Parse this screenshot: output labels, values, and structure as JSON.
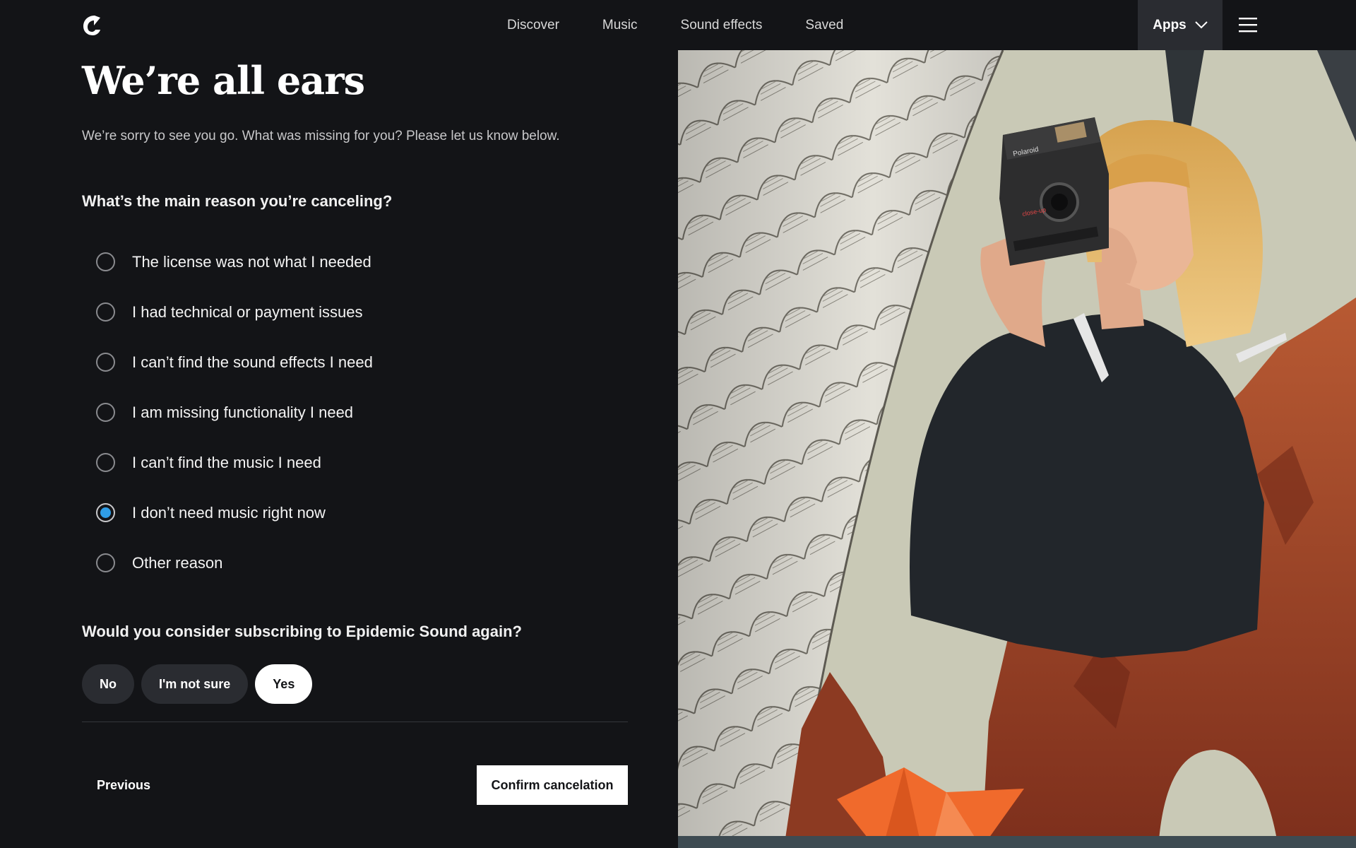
{
  "nav": {
    "logo_icon": "epidemic-sound-logo-icon",
    "links": [
      "Discover",
      "Music",
      "Sound effects",
      "Saved"
    ],
    "apps_label": "Apps",
    "apps_icon": "chevron-down-icon",
    "menu_icon": "hamburger-menu-icon"
  },
  "page": {
    "title": "We’re all ears",
    "subtitle": "We’re sorry to see you go. What was missing for you? Please let us know below."
  },
  "reason_question": {
    "label": "What’s the main reason you’re canceling?",
    "options": [
      "The license was not what I needed",
      "I had technical or payment issues",
      "I can’t find the sound effects I need",
      "I am missing functionality I need",
      "I can’t find the music I need",
      "I don’t need music right now",
      "Other reason"
    ],
    "selected_index": 5
  },
  "resubscribe_question": {
    "label": "Would you consider subscribing to Epidemic Sound again?",
    "options": [
      "No",
      "I'm not sure",
      "Yes"
    ],
    "selected": "Yes"
  },
  "footer": {
    "previous_label": "Previous",
    "confirm_label": "Confirm cancelation"
  },
  "colors": {
    "background": "#131417",
    "radio_selected": "#2f9de6",
    "pill_bg": "#2a2c31",
    "pill_active_bg": "#ffffff",
    "hero_bg": "#c9c9b6",
    "rock": "#a9482a",
    "paper_boat": "#f06a2c"
  }
}
